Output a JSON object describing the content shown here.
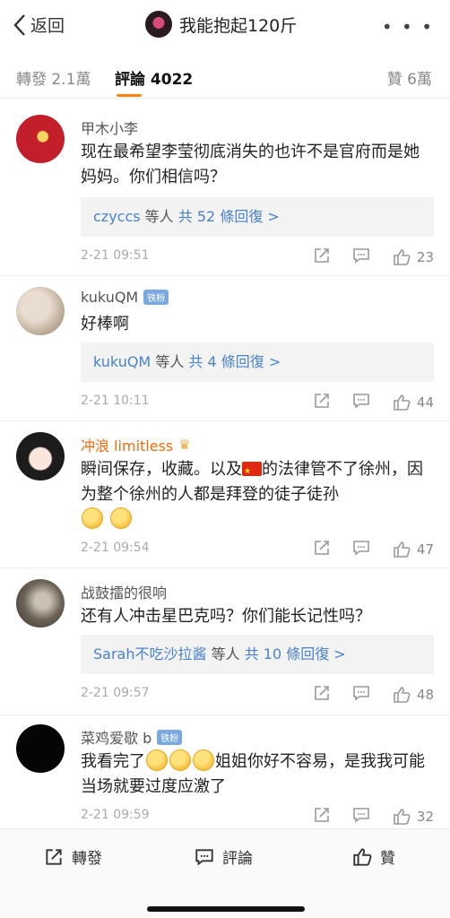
{
  "nav": {
    "back_label": "返回",
    "title": "我能抱起120斤",
    "more": "• • •"
  },
  "tabs": {
    "reposts": "轉發 2.1萬",
    "comments": "評論 4022",
    "likes": "贊 6萬"
  },
  "comments": [
    {
      "name": "甲木小李",
      "text": "现在最希望李莹彻底消失的也许不是官府而是她妈妈。你们相信吗？",
      "reply_user": "czyccs",
      "reply_mid": " 等人 ",
      "reply_count": "共 52 條回復 >",
      "time": "2-21 09:51",
      "likes": "23"
    },
    {
      "name": "kukuQM",
      "badge": "铁粉",
      "text": "好棒啊",
      "reply_user": "kukuQM",
      "reply_mid": " 等人 ",
      "reply_count": "共 4 條回復 >",
      "time": "2-21 10:11",
      "likes": "44"
    },
    {
      "name": "冲浪 limitless",
      "text_a": "瞬间保存，收藏。以及",
      "text_b": "的法律管不了徐州，因为整个徐州的人都是拜登的徒子徒孙",
      "time": "2-21 09:54",
      "likes": "47"
    },
    {
      "name": "战鼓擂的很响",
      "text": "还有人冲击星巴克吗？你们能长记性吗？",
      "reply_user": "Sarah不吃沙拉酱",
      "reply_mid": " 等人 ",
      "reply_count": "共 10 條回復 >",
      "time": "2-21 09:57",
      "likes": "48"
    },
    {
      "name": "菜鸡爱歇 b",
      "badge": "铁粉",
      "text_a": "我看完了",
      "text_b": "姐姐你好不容易，是我我可能当场就要过度应激了",
      "time": "2-21 09:59",
      "likes": "32"
    }
  ],
  "bottom": {
    "repost": "轉發",
    "comment": "評論",
    "like": "贊"
  }
}
